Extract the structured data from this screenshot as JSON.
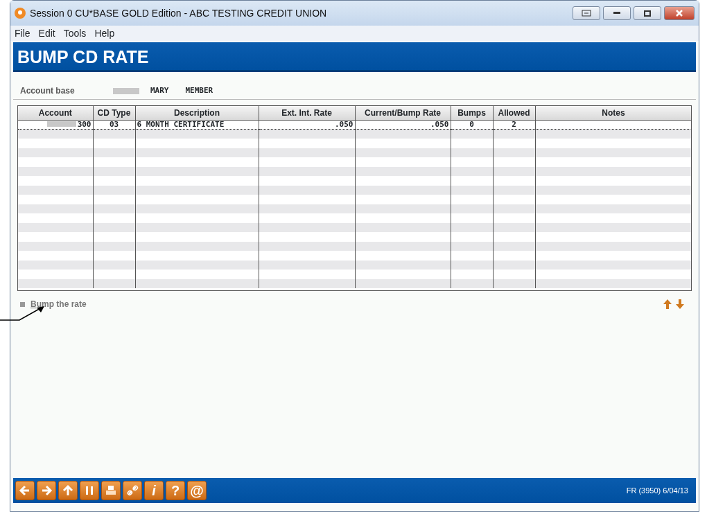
{
  "window": {
    "title": "Session 0 CU*BASE GOLD Edition - ABC TESTING CREDIT UNION"
  },
  "menu": [
    "File",
    "Edit",
    "Tools",
    "Help"
  ],
  "header": {
    "title": "BUMP CD RATE"
  },
  "account_base": {
    "label": "Account base",
    "first_name": "MARY",
    "last_name": "MEMBER"
  },
  "table": {
    "columns": [
      "Account",
      "CD Type",
      "Description",
      "Ext. Int. Rate",
      "Current/Bump Rate",
      "Bumps",
      "Allowed",
      "Notes"
    ],
    "rows": [
      {
        "selected": true,
        "cells": [
          "300",
          "03",
          "6 MONTH CERTIFICATE",
          ".050",
          ".050",
          "0",
          "2",
          ""
        ]
      }
    ]
  },
  "actions": [
    {
      "label": "Bump the rate"
    }
  ],
  "toolbar": [
    {
      "kind": "back"
    },
    {
      "kind": "forward"
    },
    {
      "kind": "up"
    },
    {
      "kind": "pause"
    },
    {
      "kind": "print"
    },
    {
      "kind": "link"
    },
    {
      "kind": "glyph",
      "text": "i"
    },
    {
      "kind": "glyph",
      "text": "?"
    },
    {
      "kind": "glyph",
      "text": "@"
    }
  ],
  "status": "FR (3950) 6/04/13"
}
